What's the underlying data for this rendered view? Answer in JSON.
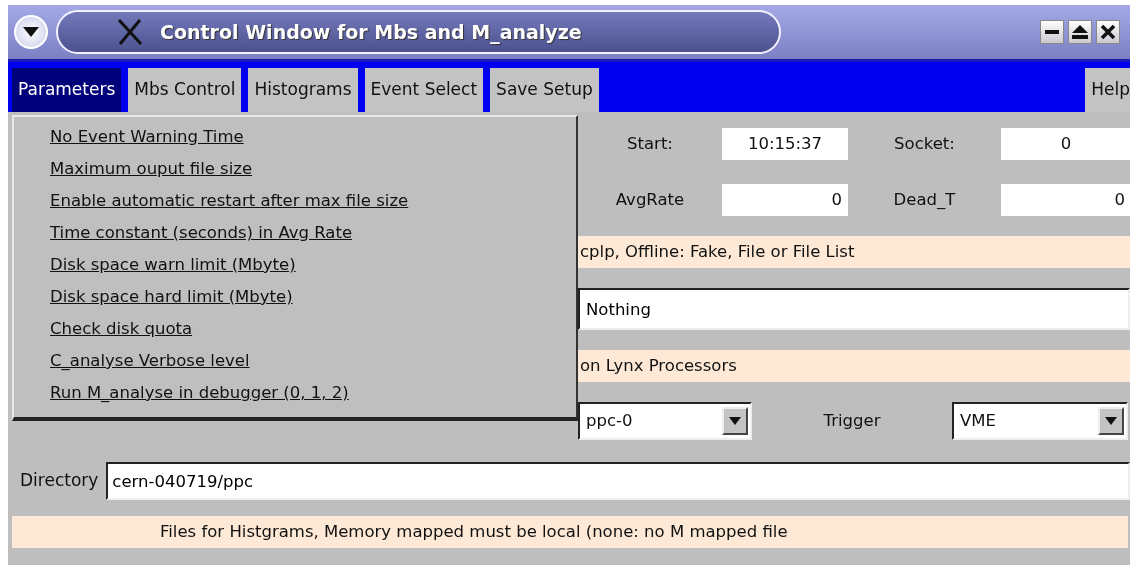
{
  "window": {
    "title": "Control Window for Mbs and M_analyze"
  },
  "menubar": [
    {
      "label": "Parameters",
      "selected": true
    },
    {
      "label": "Mbs Control",
      "selected": false
    },
    {
      "label": "Histograms",
      "selected": false
    },
    {
      "label": "Event Select",
      "selected": false
    },
    {
      "label": "Save Setup",
      "selected": false
    }
  ],
  "help": "Help",
  "dropdown": [
    "No Event Warning Time",
    "Maximum ouput file size",
    "Enable automatic restart after max file size",
    "Time constant (seconds) in Avg Rate",
    "Disk space warn limit (Mbyte)",
    "Disk space hard limit (Mbyte)",
    "Check disk quota",
    "C_analyse Verbose level",
    "Run M_analyse in debugger (0, 1, 2)"
  ],
  "status": [
    {
      "label": "Start:",
      "value": "10:15:37"
    },
    {
      "label": "Socket:",
      "value": "0"
    },
    {
      "label": "AvgRate",
      "value": "0"
    },
    {
      "label": "Dead_T",
      "value": "0"
    }
  ],
  "info_1": "cplp, Offline: Fake, File or File List",
  "input_source": "Nothing",
  "info_2": "on Lynx Processors",
  "processor": "ppc-0",
  "trigger": {
    "label": "Trigger",
    "value": "VME"
  },
  "directory": {
    "label": "Directory",
    "value": "cern-040719/ppc"
  },
  "footer": "Files for Histgrams, Memory mapped must be local (none: no M mapped file"
}
